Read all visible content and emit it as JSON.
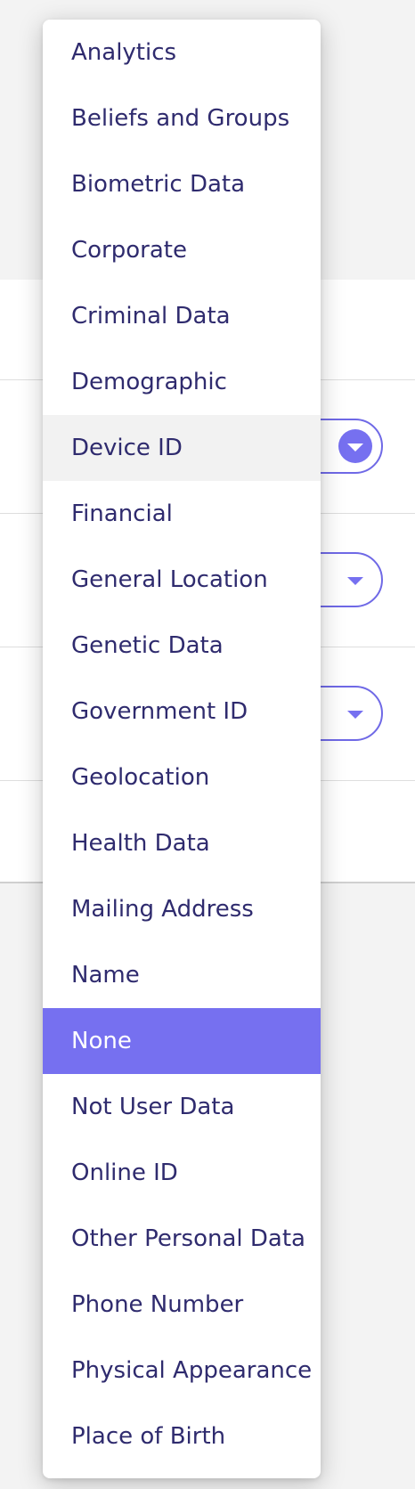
{
  "dropdown": {
    "options": [
      "Analytics",
      "Beliefs and Groups",
      "Biometric Data",
      "Corporate",
      "Criminal Data",
      "Demographic",
      "Device ID",
      "Financial",
      "General Location",
      "Genetic Data",
      "Government ID",
      "Geolocation",
      "Health Data",
      "Mailing Address",
      "Name",
      "None",
      "Not User Data",
      "Online ID",
      "Other Personal Data",
      "Phone Number",
      "Physical Appearance",
      "Place of Birth"
    ],
    "hovered_option": "Device ID",
    "selected_option": "None"
  },
  "background_selects": [
    {
      "icon": "chevron-down-icon",
      "active": true
    },
    {
      "icon": "chevron-down-icon",
      "active": false
    },
    {
      "icon": "chevron-down-icon",
      "active": false
    }
  ],
  "colors": {
    "accent": "#7670f0",
    "text": "#2f2b6e",
    "hover": "#f2f2f2",
    "page_background": "#f3f3f3"
  }
}
